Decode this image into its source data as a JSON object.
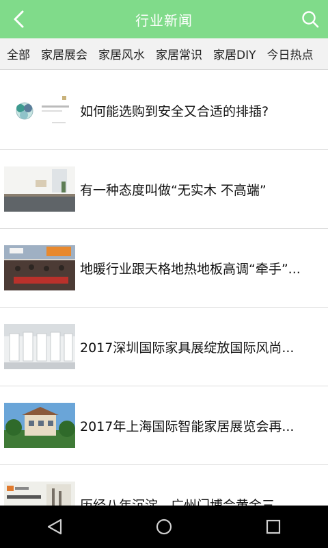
{
  "header": {
    "title": "行业新闻",
    "back_icon": "back-arrow-icon",
    "search_icon": "search-icon",
    "color": "#80db8a"
  },
  "tabs": [
    {
      "label": "全部"
    },
    {
      "label": "家居展会"
    },
    {
      "label": "家居风水"
    },
    {
      "label": "家居常识"
    },
    {
      "label": "家居DIY"
    },
    {
      "label": "今日热点"
    }
  ],
  "news": [
    {
      "title": "如何能选购到安全又合适的排插?"
    },
    {
      "title": "有一种态度叫做“无实木 不高端”"
    },
    {
      "title": "地暖行业跟天格地热地板高调“牵手”..."
    },
    {
      "title": "2017深圳国际家具展绽放国际风尚..."
    },
    {
      "title": "2017年上海国际智能家居展览会再..."
    },
    {
      "title": "历经八年沉淀，广州门博会黄金三..."
    }
  ],
  "navbar": {
    "back": "nav-back-icon",
    "home": "nav-home-icon",
    "recent": "nav-recent-icon"
  }
}
